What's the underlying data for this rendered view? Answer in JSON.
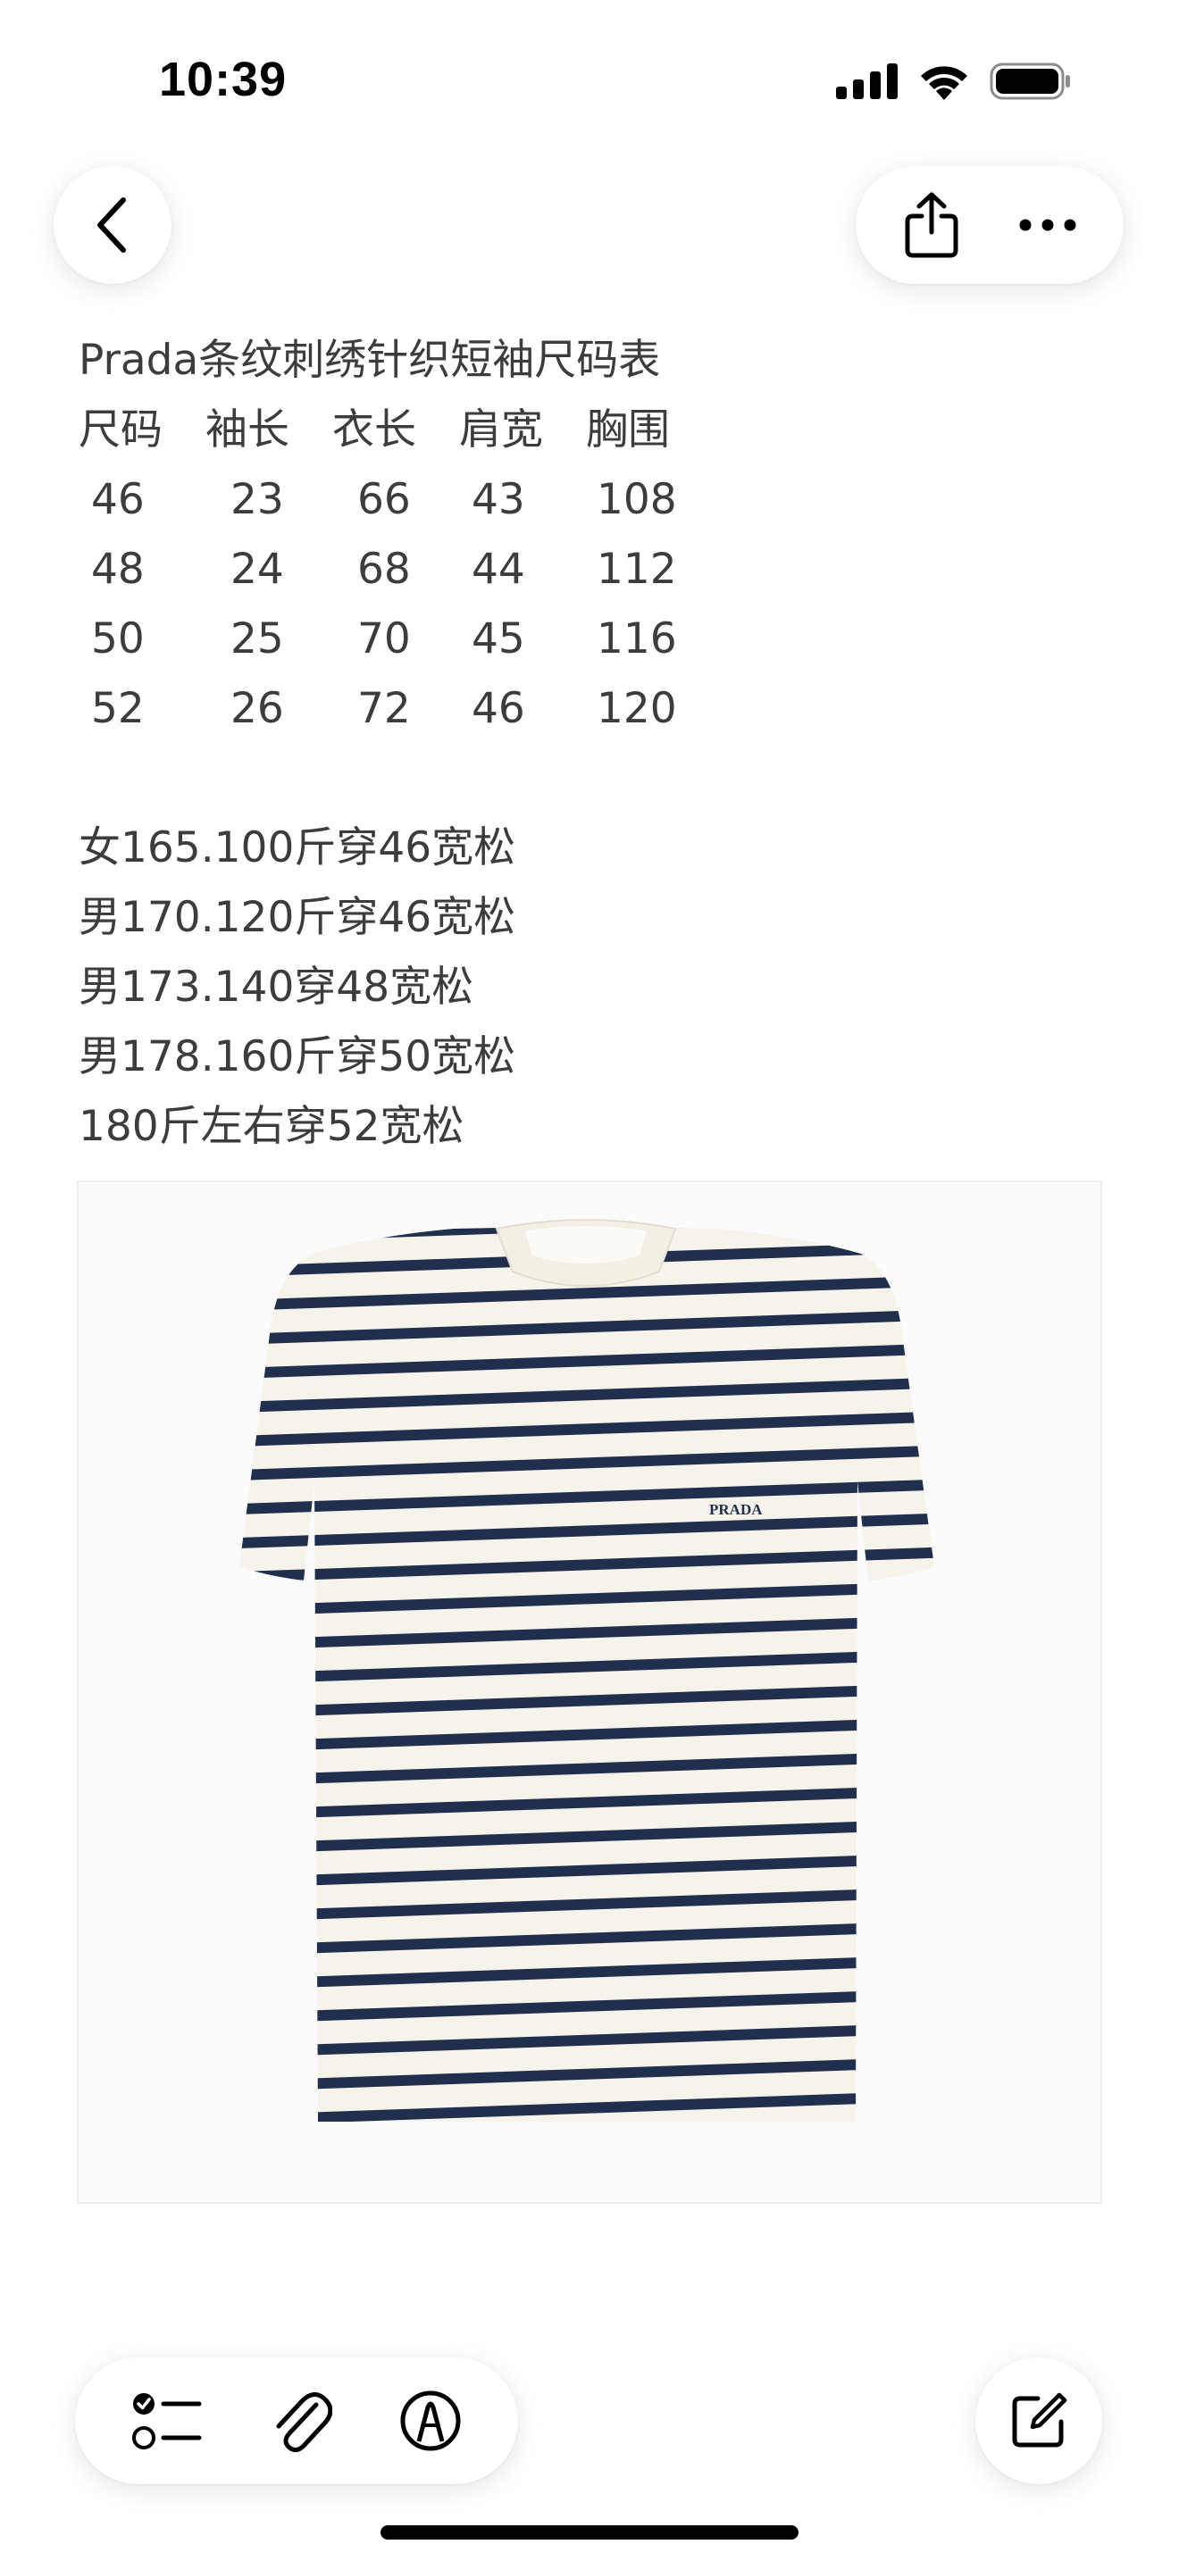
{
  "status_bar": {
    "time": "10:39"
  },
  "nav": {
    "back_icon": "chevron-left-icon",
    "share_icon": "share-icon",
    "more_icon": "ellipsis-icon"
  },
  "note": {
    "title": "Prada条纹刺绣针织短袖尺码表",
    "size_table": {
      "headers": [
        "尺码",
        "袖长",
        "衣长",
        "肩宽",
        "胸围"
      ],
      "rows": [
        [
          "46",
          "23",
          "66",
          "43",
          "108"
        ],
        [
          "48",
          "24",
          "68",
          "44",
          "112"
        ],
        [
          "50",
          "25",
          "70",
          "45",
          "116"
        ],
        [
          "52",
          "26",
          "72",
          "46",
          "120"
        ]
      ]
    },
    "fit_notes": [
      "女165.100斤穿46宽松",
      "男170.120斤穿46宽松",
      "男173.140穿48宽松",
      "男178.160斤穿50宽松",
      "180斤左右穿52宽松"
    ],
    "product_logo_text": "PRADA"
  },
  "colors": {
    "stripe_navy": "#1f2f4d",
    "stripe_cream": "#f6f3ea",
    "text": "#3c3c3e"
  },
  "toolbar": {
    "checklist_icon": "checklist-icon",
    "attach_icon": "paperclip-icon",
    "markup_icon": "markup-pen-icon",
    "compose_icon": "compose-icon"
  }
}
